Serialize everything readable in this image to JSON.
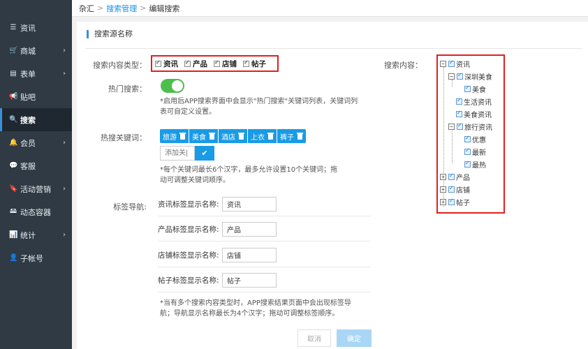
{
  "sidebar": {
    "items": [
      {
        "label": "资讯",
        "icon": "list-icon",
        "glyph": "☰",
        "chevron": false
      },
      {
        "label": "商城",
        "icon": "cart-icon",
        "glyph": "🛒",
        "chevron": true
      },
      {
        "label": "表单",
        "icon": "form-icon",
        "glyph": "▤",
        "chevron": true
      },
      {
        "label": "贴吧",
        "icon": "megaphone-icon",
        "glyph": "📢",
        "chevron": false
      },
      {
        "label": "搜索",
        "icon": "search-icon",
        "glyph": "🔍",
        "chevron": false,
        "active": true
      },
      {
        "label": "会员",
        "icon": "bell-icon",
        "glyph": "🔔",
        "chevron": true
      },
      {
        "label": "客服",
        "icon": "chat-icon",
        "glyph": "💬",
        "chevron": false
      },
      {
        "label": "活动营销",
        "icon": "bookmark-icon",
        "glyph": "🔖",
        "chevron": true
      },
      {
        "label": "动态容器",
        "icon": "drive-icon",
        "glyph": "🖴",
        "chevron": false
      },
      {
        "label": "统计",
        "icon": "bar-chart-icon",
        "glyph": "📊",
        "chevron": true
      },
      {
        "label": "子帐号",
        "icon": "user-icon",
        "glyph": "👤",
        "chevron": false
      }
    ]
  },
  "breadcrumb": {
    "root": "杂汇",
    "parent": "搜索管理",
    "current": "编辑搜索",
    "sep": ">"
  },
  "section_title": "搜索源名称",
  "content_type": {
    "label": "搜索内容类型：",
    "options": [
      "资讯",
      "产品",
      "店铺",
      "帖子"
    ]
  },
  "hot_search": {
    "label": "热门搜索：",
    "enabled": true,
    "note_line1": "*启用后APP搜索界面中会显示\"热门搜索\"关键词列表，关键词列",
    "note_line2": "表可自定义设置。"
  },
  "hot_keywords": {
    "label": "热搜关键词：",
    "tags": [
      "旅游",
      "美食",
      "酒店",
      "上衣",
      "裤子"
    ],
    "input_placeholder": "添加关|",
    "confirm_glyph": "✔",
    "note_line1": "*每个关键词最长6个汉字，最多允许设置10个关键词；拖",
    "note_line2": "动可调整关键词顺序。"
  },
  "tab_nav": {
    "label": "标签导航:",
    "rows": [
      {
        "label": "资讯标签显示名称:",
        "value": "资讯"
      },
      {
        "label": "产品标签显示名称:",
        "value": "产品"
      },
      {
        "label": "店铺标签显示名称:",
        "value": "店铺"
      },
      {
        "label": "帖子标签显示名称:",
        "value": "帖子"
      }
    ],
    "note_line1": "*当有多个搜索内容类型时，APP搜索结果页面中会出现标签导",
    "note_line2": "航；导航显示名称最长为4个汉字；拖动可调整标签顺序。"
  },
  "search_content": {
    "label": "搜索内容：",
    "tree": {
      "n0": {
        "label": "资讯",
        "toggle": "−"
      },
      "n1": {
        "label": "深圳美食",
        "toggle": "−"
      },
      "n2": {
        "label": "美食"
      },
      "n3": {
        "label": "生活资讯"
      },
      "n4": {
        "label": "美食资讯"
      },
      "n5": {
        "label": "旅行资讯",
        "toggle": "−"
      },
      "n6": {
        "label": "优惠"
      },
      "n7": {
        "label": "最新"
      },
      "n8": {
        "label": "最热"
      },
      "n9": {
        "label": "产品",
        "toggle": "+"
      },
      "n10": {
        "label": "店铺",
        "toggle": "+"
      },
      "n11": {
        "label": "帖子",
        "toggle": "+"
      }
    }
  },
  "buttons": {
    "cancel": "取消",
    "ok": "确定"
  },
  "colors": {
    "sidebar_bg": "#2f3a45",
    "accent": "#1a9be6",
    "toggle_on": "#4cbe4c",
    "highlight_border": "#e02020"
  }
}
